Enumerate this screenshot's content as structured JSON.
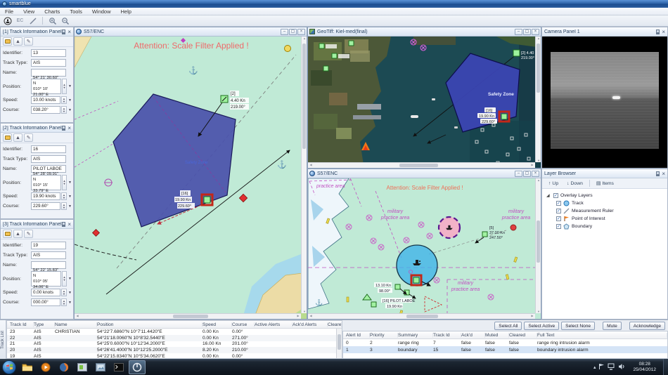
{
  "window": {
    "title": "smartblue",
    "menus": [
      "File",
      "View",
      "Charts",
      "Tools",
      "Window",
      "Help"
    ]
  },
  "toolbar": {
    "ec_label": "EC"
  },
  "field_labels": {
    "identifier": "Identifier:",
    "track_type": "Track Type:",
    "name": "Name:",
    "position": "Position:",
    "speed": "Speed:",
    "course": "Course:"
  },
  "track_panels": [
    {
      "title": "[1] Track Information Panel",
      "identifier": "13",
      "track_type": "AIS",
      "name": "",
      "lat": "54° 21' 30.60\" N",
      "lon": "010° 10' 21.00\" E",
      "speed": "10.00 knots",
      "course": "038.20°"
    },
    {
      "title": "[2] Track Information Panel",
      "identifier": "16",
      "track_type": "AIS",
      "name": "PILOT LABOE",
      "lat": "54° 28' 09.91\" N",
      "lon": "010° 15' 33.79\" E",
      "speed": "19.90 knots",
      "course": "229.60°"
    },
    {
      "title": "[3] Track Information Panel",
      "identifier": "19",
      "track_type": "AIS",
      "name": "",
      "lat": "54° 22' 15.83\" N",
      "lon": "010° 05' 34.06\" E",
      "speed": "0.00 knots",
      "course": "000.00°"
    }
  ],
  "charts": {
    "enc_main": {
      "title": "S57/ENC",
      "warning": "Attention: Scale Filter Applied !",
      "zone": "Safety Zone",
      "m2_id": "[2]",
      "m2_speed": "4.40 Kn",
      "m2_course": "219.00°",
      "sel_id": "[16]",
      "sel_speed": "19.90 Kn",
      "sel_course": "229.60°"
    },
    "geotiff": {
      "title": "GeoTiff: Kiel-med(final)",
      "zone": "Safety Zone",
      "m2a": "[2] 4.40 Kn",
      "m2b": "219.00°",
      "sela": "[16]",
      "selb": "19.90 Kn",
      "selc": "229.60°"
    },
    "enc_small": {
      "title": "S57/ENC",
      "warning": "Attention: Scale Filter Applied !",
      "practice": "practice area",
      "mil1": "military",
      "mil2": "practice area",
      "m5_id": "[5]",
      "m5_speed": "37.00 Kn",
      "m5_course": "247.50°",
      "c1": "13.10 Kn",
      "c2": "98.00°",
      "pilot": "[16] PILOT LABOE",
      "pilot_speed": "19.90 Kn"
    }
  },
  "camera": {
    "title": "Camera Panel 1"
  },
  "layer_browser": {
    "title": "Layer Browser",
    "up": "Up",
    "down": "Down",
    "items": "Items",
    "root": "Overlay Layers",
    "layers": [
      {
        "label": "Track"
      },
      {
        "label": "Measurement Ruler"
      },
      {
        "label": "Point of Interest"
      },
      {
        "label": "Boundary"
      }
    ]
  },
  "track_list": {
    "tab": "Track List",
    "columns": [
      "Track Id",
      "Type",
      "Name",
      "Position",
      "Speed",
      "Course",
      "Active Alerts",
      "Ack'd Alerts",
      "Cleared Alerts"
    ],
    "rows": [
      [
        "23",
        "AIS",
        "CHRISTIAN",
        "54°22'7.6860\"N 10°7'11.4420\"E",
        "0.00 Kn",
        "0.00°",
        "",
        "",
        ""
      ],
      [
        "22",
        "AIS",
        "",
        "54°21'18.0060\"N 10°8'32.5440\"E",
        "0.00 Kn",
        "271.00°",
        "",
        "",
        ""
      ],
      [
        "21",
        "AIS",
        "",
        "54°25'0.6000\"N 10°12'34.2000\"E",
        "16.00 Kn",
        "201.00°",
        "",
        "",
        ""
      ],
      [
        "20",
        "AIS",
        "",
        "54°26'41.4000\"N 10°12'25.2000\"E",
        "8.20 Kn",
        "210.00°",
        "",
        "",
        ""
      ],
      [
        "19",
        "AIS",
        "",
        "54°22'15.8340\"N 10°5'34.0620\"E",
        "0.00 Kn",
        "0.00°",
        "",
        "",
        ""
      ]
    ]
  },
  "alerts": {
    "buttons": [
      "Select All",
      "Select Active",
      "Select None",
      "Mute",
      "Acknowledge"
    ],
    "columns": [
      "Alert Id",
      "Priority",
      "Summary",
      "Track Id",
      "Ack'd",
      "Muted",
      "Cleared",
      "Full Text"
    ],
    "rows": [
      [
        "0",
        "2",
        "range ring",
        "7",
        "false",
        "false",
        "false",
        "range ring intrusion alarm"
      ],
      [
        "1",
        "3",
        "boundary",
        "15",
        "false",
        "false",
        "false",
        "boundary intrusion alarm"
      ]
    ]
  },
  "taskbar": {
    "time": "08:28",
    "date": "25/04/2012"
  }
}
